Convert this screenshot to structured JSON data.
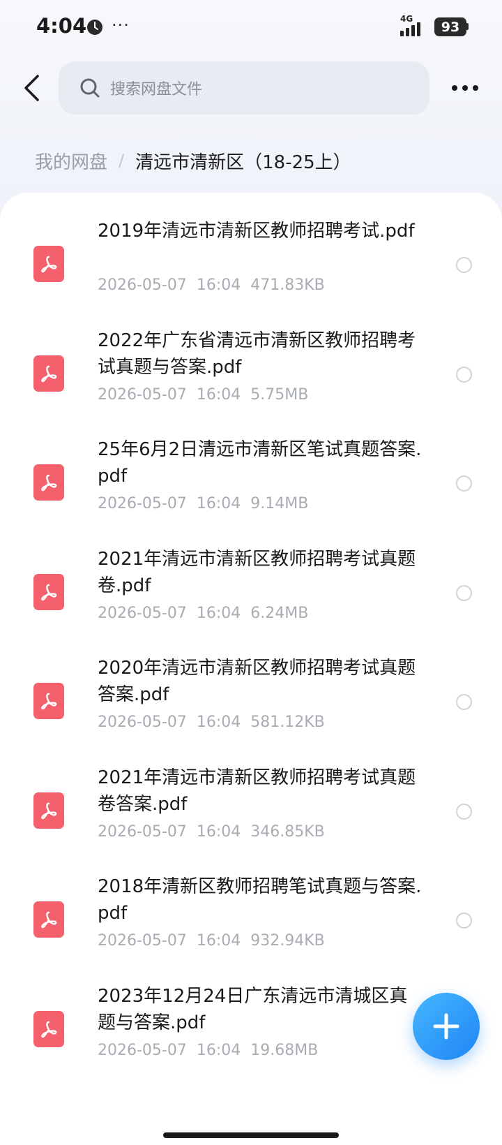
{
  "status_bar": {
    "time": "4:04",
    "dots": "···",
    "network": "4G",
    "battery": "93"
  },
  "header": {
    "search_placeholder": "搜索网盘文件"
  },
  "breadcrumb": {
    "root": "我的网盘",
    "separator": "/",
    "current": "清远市清新区（18-25上）"
  },
  "files": [
    {
      "name": "2019年清远市清新区教师招聘考试.pdf",
      "date": "2026-05-07",
      "time": "16:04",
      "size": "471.83KB"
    },
    {
      "name": "2022年广东省清远市清新区教师招聘考试真题与答案.pdf",
      "date": "2026-05-07",
      "time": "16:04",
      "size": "5.75MB"
    },
    {
      "name": "25年6月2日清远市清新区笔试真题答案.pdf",
      "date": "2026-05-07",
      "time": "16:04",
      "size": "9.14MB"
    },
    {
      "name": "2021年清远市清新区教师招聘考试真题卷.pdf",
      "date": "2026-05-07",
      "time": "16:04",
      "size": "6.24MB"
    },
    {
      "name": "2020年清远市清新区教师招聘考试真题答案.pdf",
      "date": "2026-05-07",
      "time": "16:04",
      "size": "581.12KB"
    },
    {
      "name": "2021年清远市清新区教师招聘考试真题卷答案.pdf",
      "date": "2026-05-07",
      "time": "16:04",
      "size": "346.85KB"
    },
    {
      "name": "2018年清新区教师招聘笔试真题与答案.pdf",
      "date": "2026-05-07",
      "time": "16:04",
      "size": "932.94KB"
    },
    {
      "name": "2023年12月24日广东清远市清城区真题与答案.pdf",
      "date": "2026-05-07",
      "time": "16:04",
      "size": "19.68MB"
    }
  ],
  "icons": {
    "file_type": "pdf-icon",
    "fab": "plus-icon"
  },
  "colors": {
    "pdf": "#f4606b",
    "fab": "#1f86f5"
  }
}
